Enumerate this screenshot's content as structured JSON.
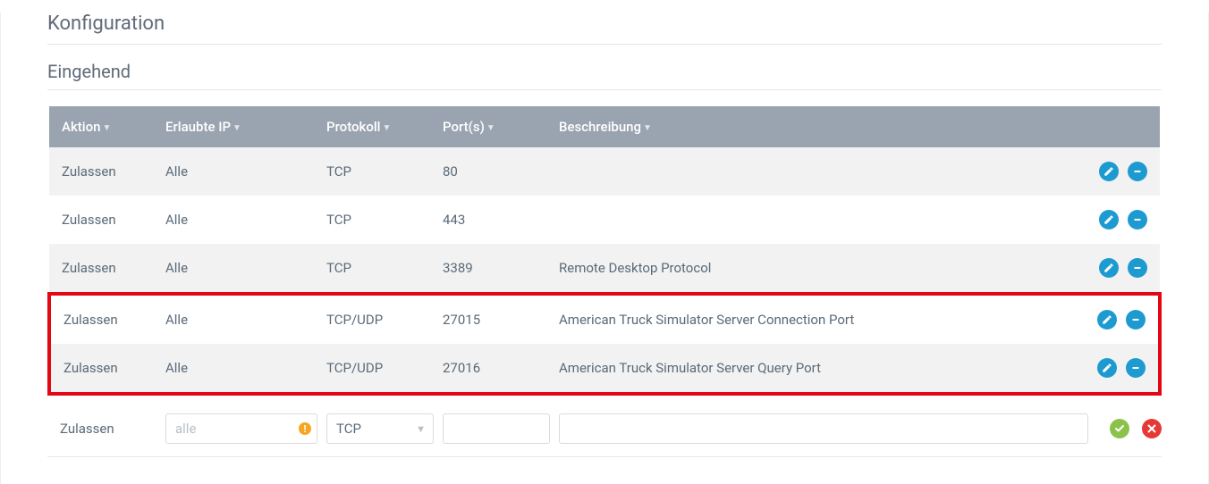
{
  "section_title": "Konfiguration",
  "subsection_title": "Eingehend",
  "headers": {
    "action": "Aktion",
    "ip": "Erlaubte IP",
    "protocol": "Protokoll",
    "ports": "Port(s)",
    "description": "Beschreibung"
  },
  "rows": [
    {
      "action": "Zulassen",
      "ip": "Alle",
      "protocol": "TCP",
      "ports": "80",
      "description": ""
    },
    {
      "action": "Zulassen",
      "ip": "Alle",
      "protocol": "TCP",
      "ports": "443",
      "description": ""
    },
    {
      "action": "Zulassen",
      "ip": "Alle",
      "protocol": "TCP",
      "ports": "3389",
      "description": "Remote Desktop Protocol"
    },
    {
      "action": "Zulassen",
      "ip": "Alle",
      "protocol": "TCP/UDP",
      "ports": "27015",
      "description": "American Truck Simulator Server Connection Port"
    },
    {
      "action": "Zulassen",
      "ip": "Alle",
      "protocol": "TCP/UDP",
      "ports": "27016",
      "description": "American Truck Simulator Server Query Port"
    }
  ],
  "add_row": {
    "action_label": "Zulassen",
    "ip_placeholder": "alle",
    "protocol_value": "TCP",
    "ports_value": "",
    "description_value": ""
  },
  "icons": {
    "edit": "edit-icon",
    "remove": "remove-icon",
    "confirm": "check-icon",
    "cancel": "close-icon",
    "warning": "warning-icon",
    "dropdown": "chevron-down-icon",
    "sort": "sort-icon"
  }
}
